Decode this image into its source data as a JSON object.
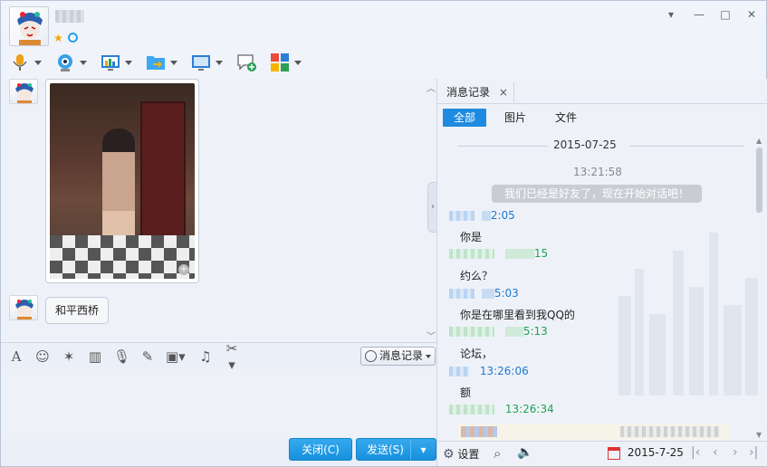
{
  "window": {
    "buttons": {
      "minimize": "▾",
      "min": "—",
      "max": "□",
      "close": "✕"
    }
  },
  "toolbar": {
    "icons": [
      "microphone-icon",
      "webcam-icon",
      "screen-share-icon",
      "file-transfer-icon",
      "remote-desktop-icon",
      "add-chat-icon",
      "apps-icon"
    ]
  },
  "chat": {
    "messages": [
      {
        "type": "image"
      },
      {
        "type": "text",
        "text": "和平西桥"
      }
    ]
  },
  "input_toolbar": {
    "history_button": "消息记录"
  },
  "buttons": {
    "close": "关闭(C)",
    "send": "发送(S)"
  },
  "history_panel": {
    "tab_title": "消息记录",
    "tab_close": "×",
    "filters": [
      "全部",
      "图片",
      "文件"
    ],
    "active_filter": "全部",
    "date_header": "2015-07-25",
    "system_time": "13:21:58",
    "system_message": "我们已经是好友了，现在开始对话吧！",
    "entries": [
      {
        "time": "2:05",
        "color": "blue",
        "text": "你是"
      },
      {
        "time": "15",
        "color": "green",
        "text": "约么？"
      },
      {
        "time": "5:03",
        "color": "blue",
        "text": "你是在哪里看到我QQ的"
      },
      {
        "time": "5:13",
        "color": "green",
        "text": "论坛，"
      },
      {
        "time": "13:26:06",
        "color": "blue",
        "text": "额"
      },
      {
        "time": "13:26:34",
        "color": "green",
        "text": ""
      }
    ],
    "bottom": {
      "settings_label": "设置",
      "date": "2015-7-25"
    }
  }
}
